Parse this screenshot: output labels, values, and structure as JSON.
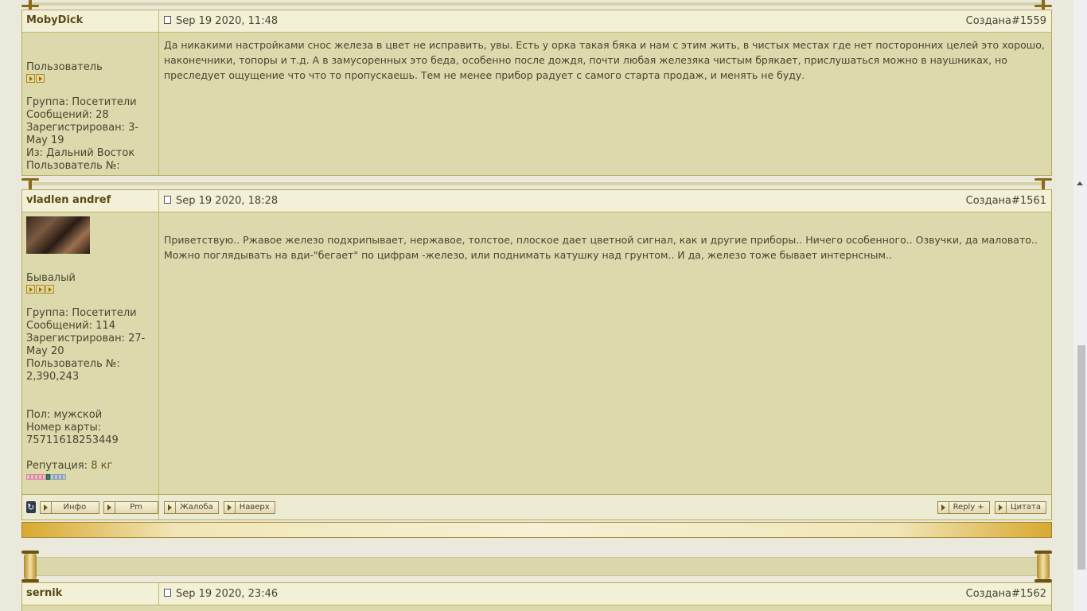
{
  "post1": {
    "author": "MobyDick",
    "date": "Sep 19 2020, 11:48",
    "created_label": "Создана ",
    "post_number": "#1559",
    "rank": "Пользователь",
    "group": "Группа: Посетители",
    "messages": "Сообщений: 28",
    "registered": "Зарегистрирован: 3-May 19",
    "from": "Из: Дальний Восток",
    "user_number": "Пользователь №:",
    "text": "Да никакими настройками снос железа в цвет не исправить, увы. Есть у орка такая бяка и нам с этим жить, в чистых местах где нет посторонних целей это хорошо, наконечники, топоры и т.д. А в замусоренных это беда, особенно после дождя, почти любая железяка чистым брякает, прислушаться можно в наушниках, но преследует ощущение что что то пропускаешь. Тем не менее прибор радует с самого старта продаж, и менять не буду."
  },
  "post2": {
    "author": "vladlen andref",
    "date": "Sep 19 2020, 18:28",
    "created_label": "Создана ",
    "post_number": "#1561",
    "rank": "Бывалый",
    "group": "Группа: Посетители",
    "messages": "Сообщений: 114",
    "registered": "Зарегистрирован: 27-May 20",
    "user_number": "Пользователь №: 2,390,243",
    "gender": "Пол: мужской",
    "card": "Номер карты: 75711618253449",
    "reputation_label": "Репутация: ",
    "reputation_value": "8 кг",
    "text": "Приветствую.. Ржавое железо подхрипывает, нержавое, толстое, плоское дает цветной сигнал, как и другие приборы.. Ничего особенного.. Озвучки, да маловато.. Можно поглядывать на вди-\"бегает\" по цифрам -железо, или поднимать катушку над грунтом.. И да, железо тоже бывает интернсным..",
    "buttons": {
      "info": "Инфо",
      "pm": "Pm",
      "report": "Жалоба",
      "top": "Наверх",
      "reply": "Reply +",
      "quote": "Цитата"
    }
  },
  "post3": {
    "author": "sernik",
    "date": "Sep 19 2020, 23:46",
    "created_label": "Создана ",
    "post_number": "#1562"
  },
  "colors": {
    "accent": "#d9a930",
    "panel": "#dcd9ad",
    "header": "#f2f0d6"
  }
}
